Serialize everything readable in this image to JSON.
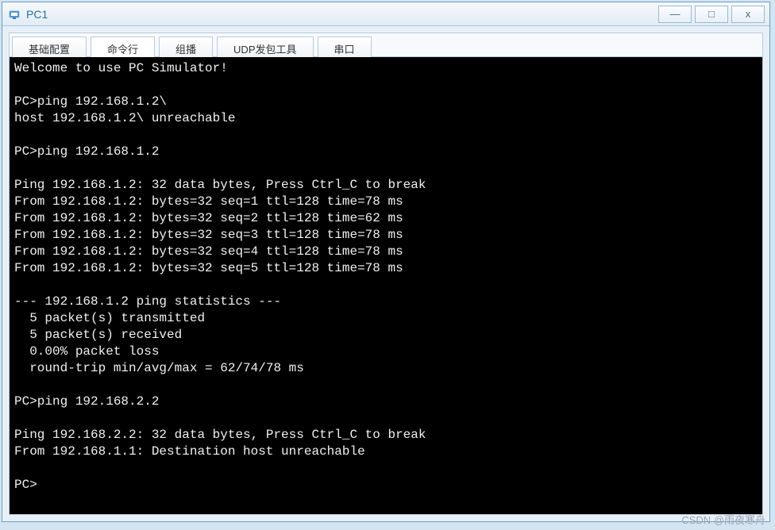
{
  "window": {
    "title": "PC1",
    "controls": {
      "minimize": "—",
      "maximize": "□",
      "close": "x"
    }
  },
  "tabs": [
    {
      "label": "基础配置",
      "active": false
    },
    {
      "label": "命令行",
      "active": true
    },
    {
      "label": "组播",
      "active": false
    },
    {
      "label": "UDP发包工具",
      "active": false
    },
    {
      "label": "串口",
      "active": false
    }
  ],
  "terminal": {
    "lines": [
      "Welcome to use PC Simulator!",
      "",
      "PC>ping 192.168.1.2\\",
      "host 192.168.1.2\\ unreachable",
      "",
      "PC>ping 192.168.1.2",
      "",
      "Ping 192.168.1.2: 32 data bytes, Press Ctrl_C to break",
      "From 192.168.1.2: bytes=32 seq=1 ttl=128 time=78 ms",
      "From 192.168.1.2: bytes=32 seq=2 ttl=128 time=62 ms",
      "From 192.168.1.2: bytes=32 seq=3 ttl=128 time=78 ms",
      "From 192.168.1.2: bytes=32 seq=4 ttl=128 time=78 ms",
      "From 192.168.1.2: bytes=32 seq=5 ttl=128 time=78 ms",
      "",
      "--- 192.168.1.2 ping statistics ---",
      "  5 packet(s) transmitted",
      "  5 packet(s) received",
      "  0.00% packet loss",
      "  round-trip min/avg/max = 62/74/78 ms",
      "",
      "PC>ping 192.168.2.2",
      "",
      "Ping 192.168.2.2: 32 data bytes, Press Ctrl_C to break",
      "From 192.168.1.1: Destination host unreachable",
      "",
      "PC>"
    ]
  },
  "watermark": "CSDN @雨夜寒舟"
}
